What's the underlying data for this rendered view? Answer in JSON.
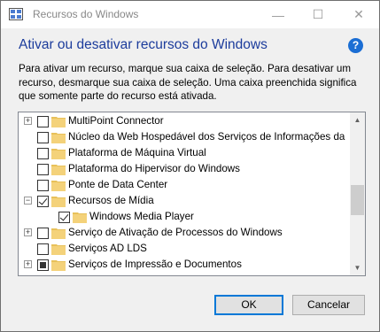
{
  "window": {
    "title": "Recursos do Windows",
    "controls": {
      "minimize": "—",
      "maximize": "☐",
      "close": "✕"
    }
  },
  "header": {
    "title": "Ativar ou desativar recursos do Windows",
    "help_icon": "?"
  },
  "description": {
    "lines": [
      "Para ativar um recurso, marque sua caixa de seleção. Para desativar um",
      "recurso, desmarque sua caixa de seleção. Uma caixa preenchida significa",
      "que somente parte do recurso está ativada."
    ]
  },
  "features": [
    {
      "label": "MultiPoint Connector",
      "expandable": true,
      "state": "unchecked",
      "indent": 0
    },
    {
      "label": "Núcleo da Web Hospedável dos Serviços de Informações da",
      "expandable": false,
      "state": "unchecked",
      "indent": 0
    },
    {
      "label": "Plataforma de Máquina Virtual",
      "expandable": false,
      "state": "unchecked",
      "indent": 0
    },
    {
      "label": "Plataforma do Hipervisor do Windows",
      "expandable": false,
      "state": "unchecked",
      "indent": 0
    },
    {
      "label": "Ponte de Data Center",
      "expandable": false,
      "state": "unchecked",
      "indent": 0
    },
    {
      "label": "Recursos de Mídia",
      "expandable": true,
      "expanded": true,
      "state": "checked",
      "indent": 0
    },
    {
      "label": "Windows Media Player",
      "expandable": false,
      "state": "checked",
      "indent": 1
    },
    {
      "label": "Serviço de Ativação de Processos do Windows",
      "expandable": true,
      "state": "unchecked",
      "indent": 0
    },
    {
      "label": "Serviços AD LDS",
      "expandable": false,
      "state": "unchecked",
      "indent": 0
    },
    {
      "label": "Serviços de Impressão e Documentos",
      "expandable": true,
      "state": "partial",
      "indent": 0
    }
  ],
  "scrollbar": {
    "up": "▲",
    "down": "▼"
  },
  "buttons": {
    "ok": "OK",
    "cancel": "Cancelar"
  },
  "colors": {
    "heading": "#1c3c9c",
    "help": "#1b6ed4",
    "folder": "#e8c15a",
    "accent": "#0078d7"
  }
}
